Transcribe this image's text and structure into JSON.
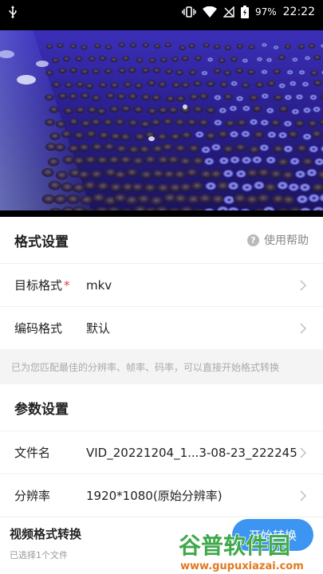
{
  "status_bar": {
    "battery_percent": "97%",
    "time": "22:22",
    "icons": [
      "usb-icon",
      "vibrate-icon",
      "wifi-icon",
      "no-signal-icon",
      "battery-charging-icon"
    ]
  },
  "video": {
    "description_icon": "video-preview"
  },
  "format_section": {
    "title": "格式设置",
    "help_label": "使用帮助",
    "target_format_label": "目标格式",
    "required_mark": "*",
    "target_format_value": "mkv",
    "codec_label": "编码格式",
    "codec_value": "默认",
    "hint": "已为您匹配最佳的分辨率、帧率、码率，可以直接开始格式转换"
  },
  "params_section": {
    "title": "参数设置",
    "filename_label": "文件名",
    "filename_value": "VID_20221204_1...3-08-23_222245",
    "resolution_label": "分辨率",
    "resolution_value": "1920*1080(原始分辨率)"
  },
  "bottom_bar": {
    "title": "视频格式转换",
    "subtitle": "已选择1个文件",
    "start_label": "开始转换"
  },
  "watermark": {
    "brand": "谷普软件园",
    "url": "www.gupuxiazai.com"
  },
  "colors": {
    "accent": "#3c95f0",
    "required": "#e53935"
  }
}
